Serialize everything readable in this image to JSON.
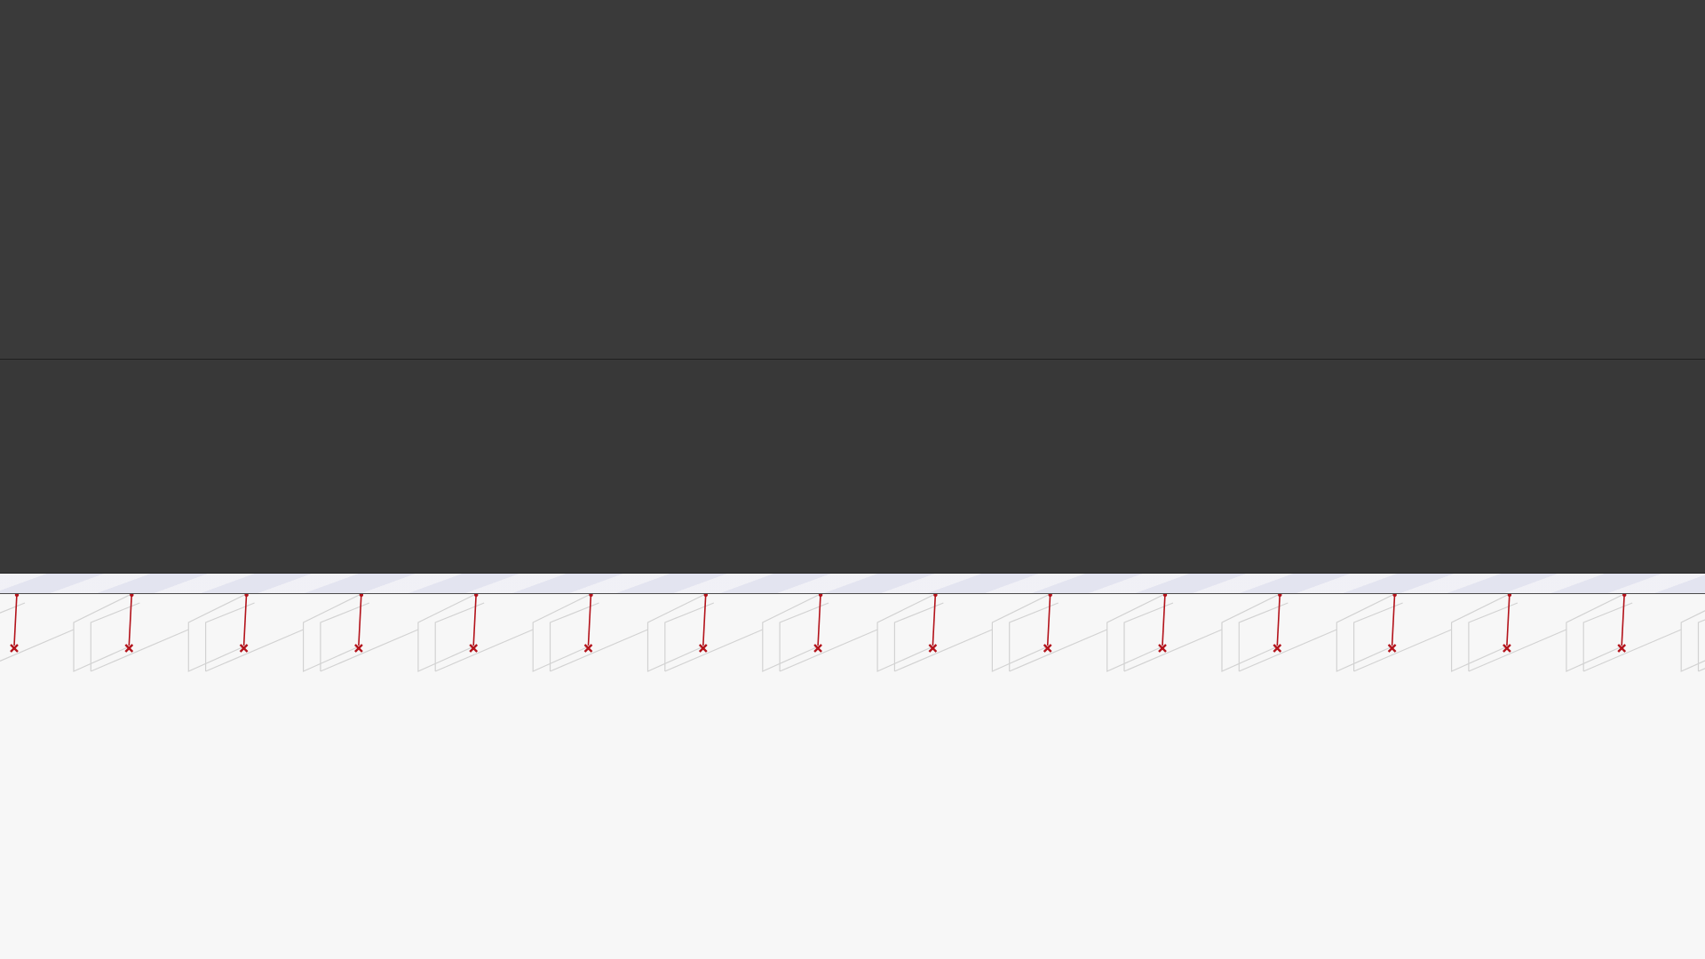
{
  "theme": {
    "upper_panel_bg": "#3a3a3a",
    "lower_panel_bg": "#383838",
    "ground_band_bg": "#e9e9f2",
    "scene_bg": "#f7f7f7",
    "frame_stroke": "#d2d2d2",
    "strut_color": "#b3131b"
  },
  "scene": {
    "objects": [
      {
        "type": "bracket-frame",
        "repeat_count": 15,
        "icon": "x-marker-icon"
      }
    ]
  }
}
